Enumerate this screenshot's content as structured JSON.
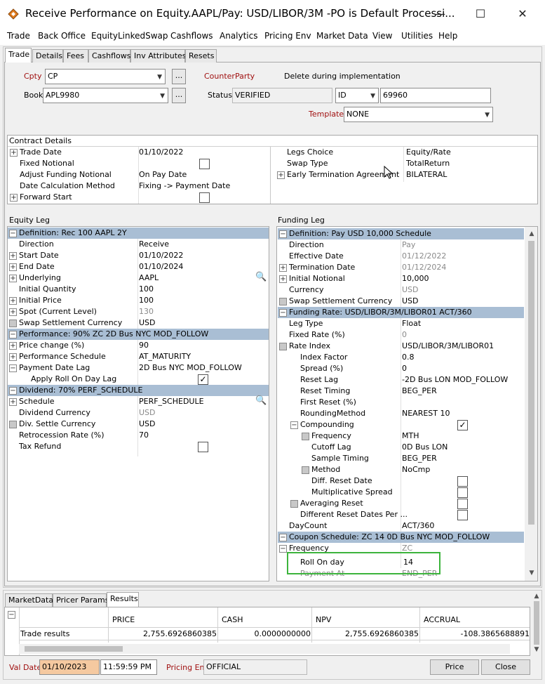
{
  "window": {
    "title": "Receive Performance on Equity.AAPL/Pay: USD/LIBOR/3M  -PO is Default Processi...",
    "minimize": "—",
    "maximize": "☐",
    "close": "✕"
  },
  "menu": [
    "Trade",
    "Back Office",
    "EquityLinkedSwap",
    "Cashflows",
    "Analytics",
    "Pricing Env",
    "Market Data",
    "View",
    "Utilities",
    "Help"
  ],
  "tabs": [
    "Trade",
    "Details",
    "Fees",
    "Cashflows",
    "Inv Attributes",
    "Resets"
  ],
  "header": {
    "cpty_label": "Cpty",
    "cpty_value": "CP",
    "counterparty_label": "CounterParty",
    "delete_note": "Delete during implementation",
    "book_label": "Book",
    "book_value": "APL9980",
    "status_label": "Status",
    "status_value": "VERIFIED",
    "id_type": "ID",
    "id_value": "69960",
    "template_label": "Template",
    "template_value": "NONE",
    "ellipsis": "..."
  },
  "contract": {
    "title": "Contract Details",
    "left_rows": [
      {
        "label": "Trade Date",
        "value": "01/10/2022"
      },
      {
        "label": "Fixed Notional",
        "value": ""
      },
      {
        "label": "Adjust Funding Notional",
        "value": "On Pay Date"
      },
      {
        "label": "Date Calculation Method",
        "value": "Fixing -> Payment Date"
      },
      {
        "label": "Forward Start",
        "value": ""
      }
    ],
    "right_rows": [
      {
        "label": "Legs Choice",
        "value": "Equity/Rate"
      },
      {
        "label": "Swap Type",
        "value": "TotalReturn"
      },
      {
        "label": "Early Termination Agreement",
        "value": "BILATERAL"
      }
    ]
  },
  "equity_leg": {
    "title": "Equity Leg",
    "rows": [
      {
        "label": "Definition: Rec 100 AAPL 2Y",
        "value": ""
      },
      {
        "label": "Direction",
        "value": "Receive"
      },
      {
        "label": "Start Date",
        "value": "01/10/2022"
      },
      {
        "label": "End Date",
        "value": "01/10/2024"
      },
      {
        "label": "Underlying",
        "value": "AAPL"
      },
      {
        "label": "Initial Quantity",
        "value": "100"
      },
      {
        "label": "Initial Price",
        "value": "100"
      },
      {
        "label": "Spot (Current Level)",
        "value": "130"
      },
      {
        "label": "Swap Settlement Currency",
        "value": "USD"
      },
      {
        "label": "Performance: 90% ZC 2D Bus NYC MOD_FOLLOW",
        "value": ""
      },
      {
        "label": "Price change (%)",
        "value": "90"
      },
      {
        "label": "Performance Schedule",
        "value": "AT_MATURITY"
      },
      {
        "label": "Payment Date Lag",
        "value": "2D Bus NYC MOD_FOLLOW"
      },
      {
        "label": "Apply Roll On Day Lag",
        "value": ""
      },
      {
        "label": "Dividend: 70% PERF_SCHEDULE",
        "value": ""
      },
      {
        "label": "Schedule",
        "value": "PERF_SCHEDULE"
      },
      {
        "label": "Dividend Currency",
        "value": "USD"
      },
      {
        "label": "Div. Settle Currency",
        "value": "USD"
      },
      {
        "label": "Retrocession Rate (%)",
        "value": "70"
      },
      {
        "label": "Tax Refund",
        "value": ""
      }
    ]
  },
  "funding_leg": {
    "title": "Funding Leg",
    "rows": [
      {
        "label": "Definition: Pay USD 10,000 Schedule",
        "value": ""
      },
      {
        "label": "Direction",
        "value": "Pay"
      },
      {
        "label": "Effective Date",
        "value": "01/12/2022"
      },
      {
        "label": "Termination Date",
        "value": "01/12/2024"
      },
      {
        "label": "Initial Notional",
        "value": "10,000"
      },
      {
        "label": "Currency",
        "value": "USD"
      },
      {
        "label": "Swap Settlement Currency",
        "value": "USD"
      },
      {
        "label": "Funding Rate: USD/LIBOR/3M/LIBOR01 ACT/360",
        "value": ""
      },
      {
        "label": "Leg Type",
        "value": "Float"
      },
      {
        "label": "Fixed Rate (%)",
        "value": "0"
      },
      {
        "label": "Rate Index",
        "value": "USD/LIBOR/3M/LIBOR01"
      },
      {
        "label": "Index Factor",
        "value": "0.8"
      },
      {
        "label": "Spread (%)",
        "value": "0"
      },
      {
        "label": "Reset Lag",
        "value": "-2D Bus LON MOD_FOLLOW"
      },
      {
        "label": "Reset Timing",
        "value": "BEG_PER"
      },
      {
        "label": "First Reset (%)",
        "value": ""
      },
      {
        "label": "RoundingMethod",
        "value": "NEAREST 10"
      },
      {
        "label": "Compounding",
        "value": ""
      },
      {
        "label": "Frequency",
        "value": "MTH"
      },
      {
        "label": "Cutoff Lag",
        "value": "0D Bus LON"
      },
      {
        "label": "Sample Timing",
        "value": "BEG_PER"
      },
      {
        "label": "Method",
        "value": "NoCmp"
      },
      {
        "label": "Diff. Reset Date",
        "value": ""
      },
      {
        "label": "Multiplicative Spread",
        "value": ""
      },
      {
        "label": "Averaging Reset",
        "value": ""
      },
      {
        "label": "Different Reset Dates Per ...",
        "value": ""
      },
      {
        "label": "DayCount",
        "value": "ACT/360"
      },
      {
        "label": "Coupon Schedule: ZC 14 0D Bus NYC MOD_FOLLOW",
        "value": ""
      },
      {
        "label": "Frequency",
        "value": "ZC"
      },
      {
        "label": "Roll On day",
        "value": "14"
      },
      {
        "label": "Payment At",
        "value": "END_PER"
      }
    ]
  },
  "results": {
    "tabs": [
      "MarketData",
      "Pricer Params",
      "Results"
    ],
    "columns": [
      "PRICE",
      "CASH",
      "NPV",
      "ACCRUAL"
    ],
    "row_label": "Trade results",
    "values": [
      "2,755.6926860385",
      "0.0000000000",
      "2,755.6926860385",
      "-108.3865688891"
    ]
  },
  "footer": {
    "valdate_label": "Val Date",
    "valdate_value": "01/10/2023",
    "time_value": "11:59:59 PM",
    "pricing_env_label": "Pricing Env",
    "pricing_env_value": "OFFICIAL",
    "price_button": "Price",
    "close_button": "Close"
  },
  "colors": {
    "section_bg": "#a9bed4",
    "highlight": "#3cb43c",
    "label_red": "#a01010",
    "valdate_bg": "#f5c9a0"
  }
}
